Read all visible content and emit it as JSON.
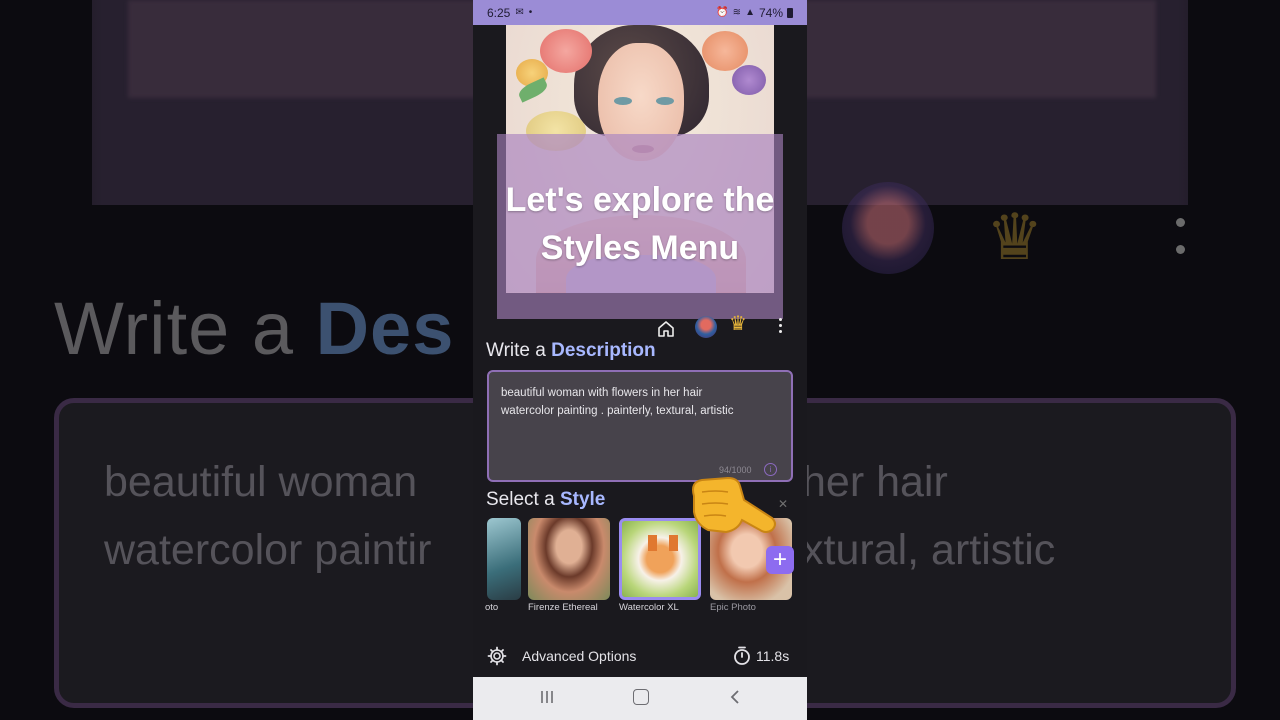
{
  "status_bar": {
    "time": "6:25",
    "battery": "74%"
  },
  "video_caption": {
    "line1": "Let's explore the",
    "line2": "Styles Menu"
  },
  "background": {
    "heading_prefix": "Write a",
    "heading_highlight": "Des",
    "text_left_1": "beautiful woman",
    "text_left_2": "watercolor paintir",
    "text_right_1": "her hair",
    "text_right_2": "xtural, artistic"
  },
  "description_section": {
    "heading_prefix": "Write a",
    "heading_highlight": "Description",
    "prompt_line1": "beautiful woman with flowers in her hair",
    "prompt_line2": "watercolor painting . painterly, textural, artistic",
    "counter": "94/1000"
  },
  "style_section": {
    "heading_prefix": "Select a",
    "heading_highlight": "Style",
    "styles": [
      {
        "label": "oto",
        "selected": false
      },
      {
        "label": "Firenze Ethereal",
        "selected": false
      },
      {
        "label": "Watercolor XL",
        "selected": true
      },
      {
        "label": "Epic Photo",
        "selected": false
      }
    ]
  },
  "advanced": {
    "label": "Advanced Options",
    "time": "11.8s"
  },
  "colors": {
    "accent": "#a8b8ff",
    "status_bar": "#9b8cd6",
    "border": "#8f6fb6",
    "add_button": "#8d6cf0"
  },
  "icons": [
    "home-icon",
    "avatar",
    "crown-icon",
    "kebab-menu-icon",
    "info-icon",
    "plus-icon",
    "gear-icon",
    "timer-icon",
    "pointing-hand-emoji"
  ]
}
